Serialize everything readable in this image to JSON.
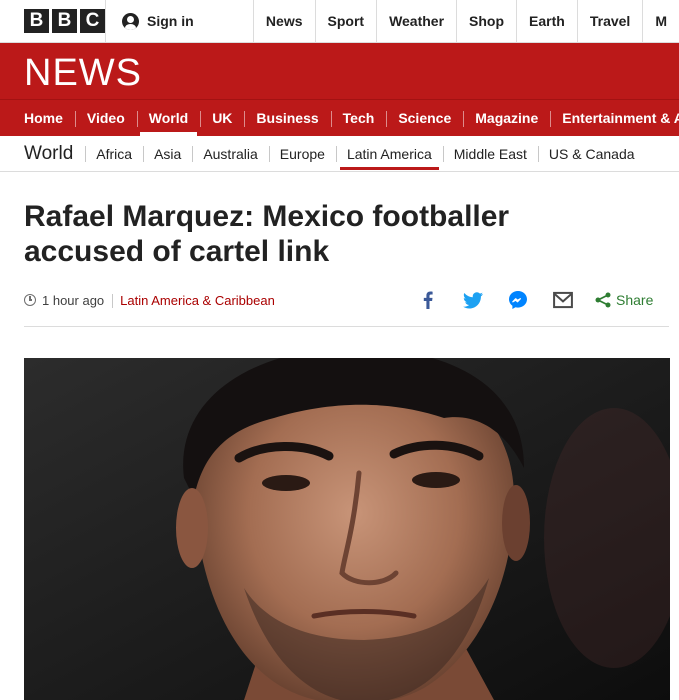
{
  "topbar": {
    "logo_letters": [
      "B",
      "B",
      "C"
    ],
    "signin_label": "Sign in",
    "nav": [
      "News",
      "Sport",
      "Weather",
      "Shop",
      "Earth",
      "Travel",
      "M"
    ]
  },
  "banner": {
    "title": "NEWS"
  },
  "sections": {
    "items": [
      "Home",
      "Video",
      "World",
      "UK",
      "Business",
      "Tech",
      "Science",
      "Magazine",
      "Entertainment & Arts"
    ],
    "active": "World"
  },
  "subnav": {
    "title": "World",
    "items": [
      "Africa",
      "Asia",
      "Australia",
      "Europe",
      "Latin America",
      "Middle East",
      "US & Canada"
    ],
    "active": "Latin America"
  },
  "article": {
    "headline": "Rafael Marquez: Mexico footballer accused of cartel link",
    "time": "1 hour ago",
    "category": "Latin America & Caribbean",
    "share_label": "Share"
  },
  "share_icons": [
    "facebook-icon",
    "twitter-icon",
    "messenger-icon",
    "email-icon",
    "share-icon"
  ],
  "colors": {
    "brand_red": "#bb1919",
    "category_red": "#a00",
    "share_green": "#2e7d32",
    "facebook_blue": "#3b5998",
    "twitter_blue": "#1da1f2",
    "messenger_blue": "#0084ff"
  }
}
